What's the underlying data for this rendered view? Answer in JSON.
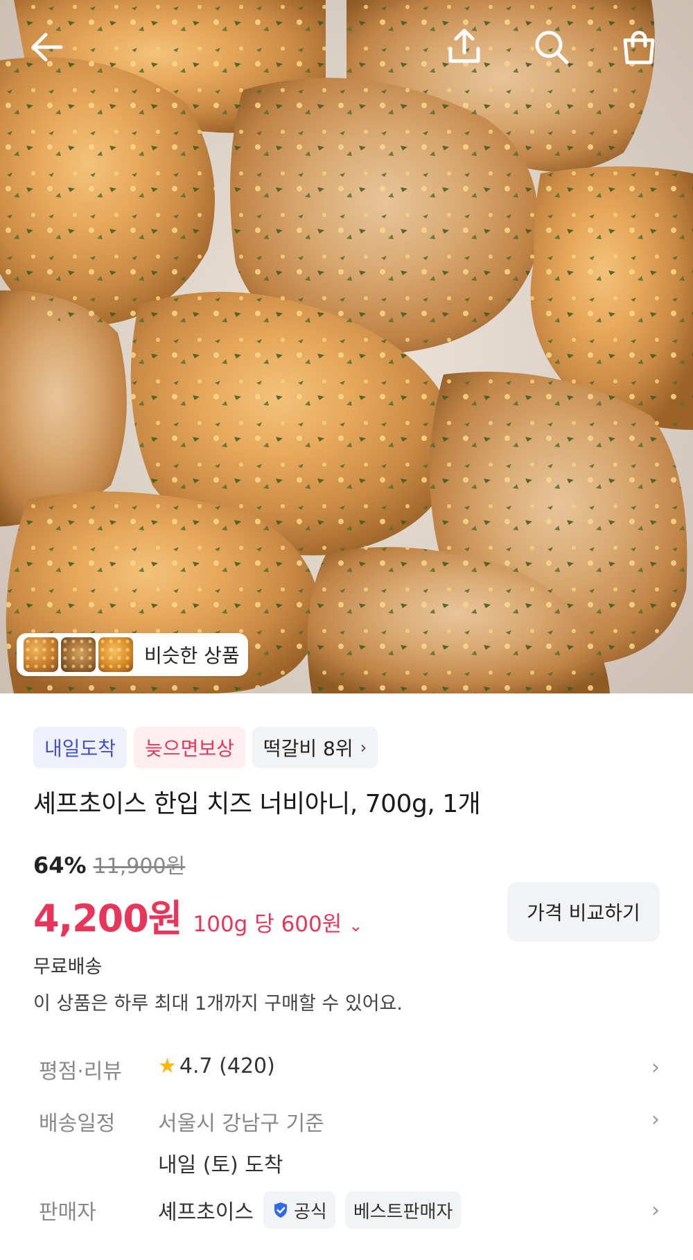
{
  "hero": {
    "similar_products_label": "비슷한 상품"
  },
  "badges": {
    "arrival": "내일도착",
    "late_compensation": "늦으면보상",
    "ranking": "떡갈비 8위"
  },
  "product": {
    "title": "셰프초이스 한입 치즈 너비아니, 700g, 1개",
    "discount_percent": "64%",
    "original_price": "11,900원",
    "sale_price": "4,200원",
    "unit_price": "100g 당 600원",
    "compare_button": "가격 비교하기",
    "shipping": "무료배송",
    "purchase_limit": "이 상품은 하루 최대 1개까지 구매할 수 있어요."
  },
  "info": {
    "rating_label": "평점·리뷰",
    "rating_value": "4.7 (420)",
    "delivery_label": "배송일정",
    "delivery_location": "서울시 강남구 기준",
    "delivery_date": "내일 (토) 도착",
    "seller_label": "판매자",
    "seller_name": "셰프초이스",
    "seller_official": "공식",
    "seller_best": "베스트판매자"
  },
  "colors": {
    "accent_red": "#e8365a",
    "badge_blue": "#4450c8",
    "star": "#f8b811"
  },
  "icons": [
    "back-arrow-icon",
    "share-icon",
    "search-icon",
    "cart-icon",
    "star-icon",
    "verified-check-icon",
    "chevron-right-icon",
    "chevron-down-icon"
  ]
}
